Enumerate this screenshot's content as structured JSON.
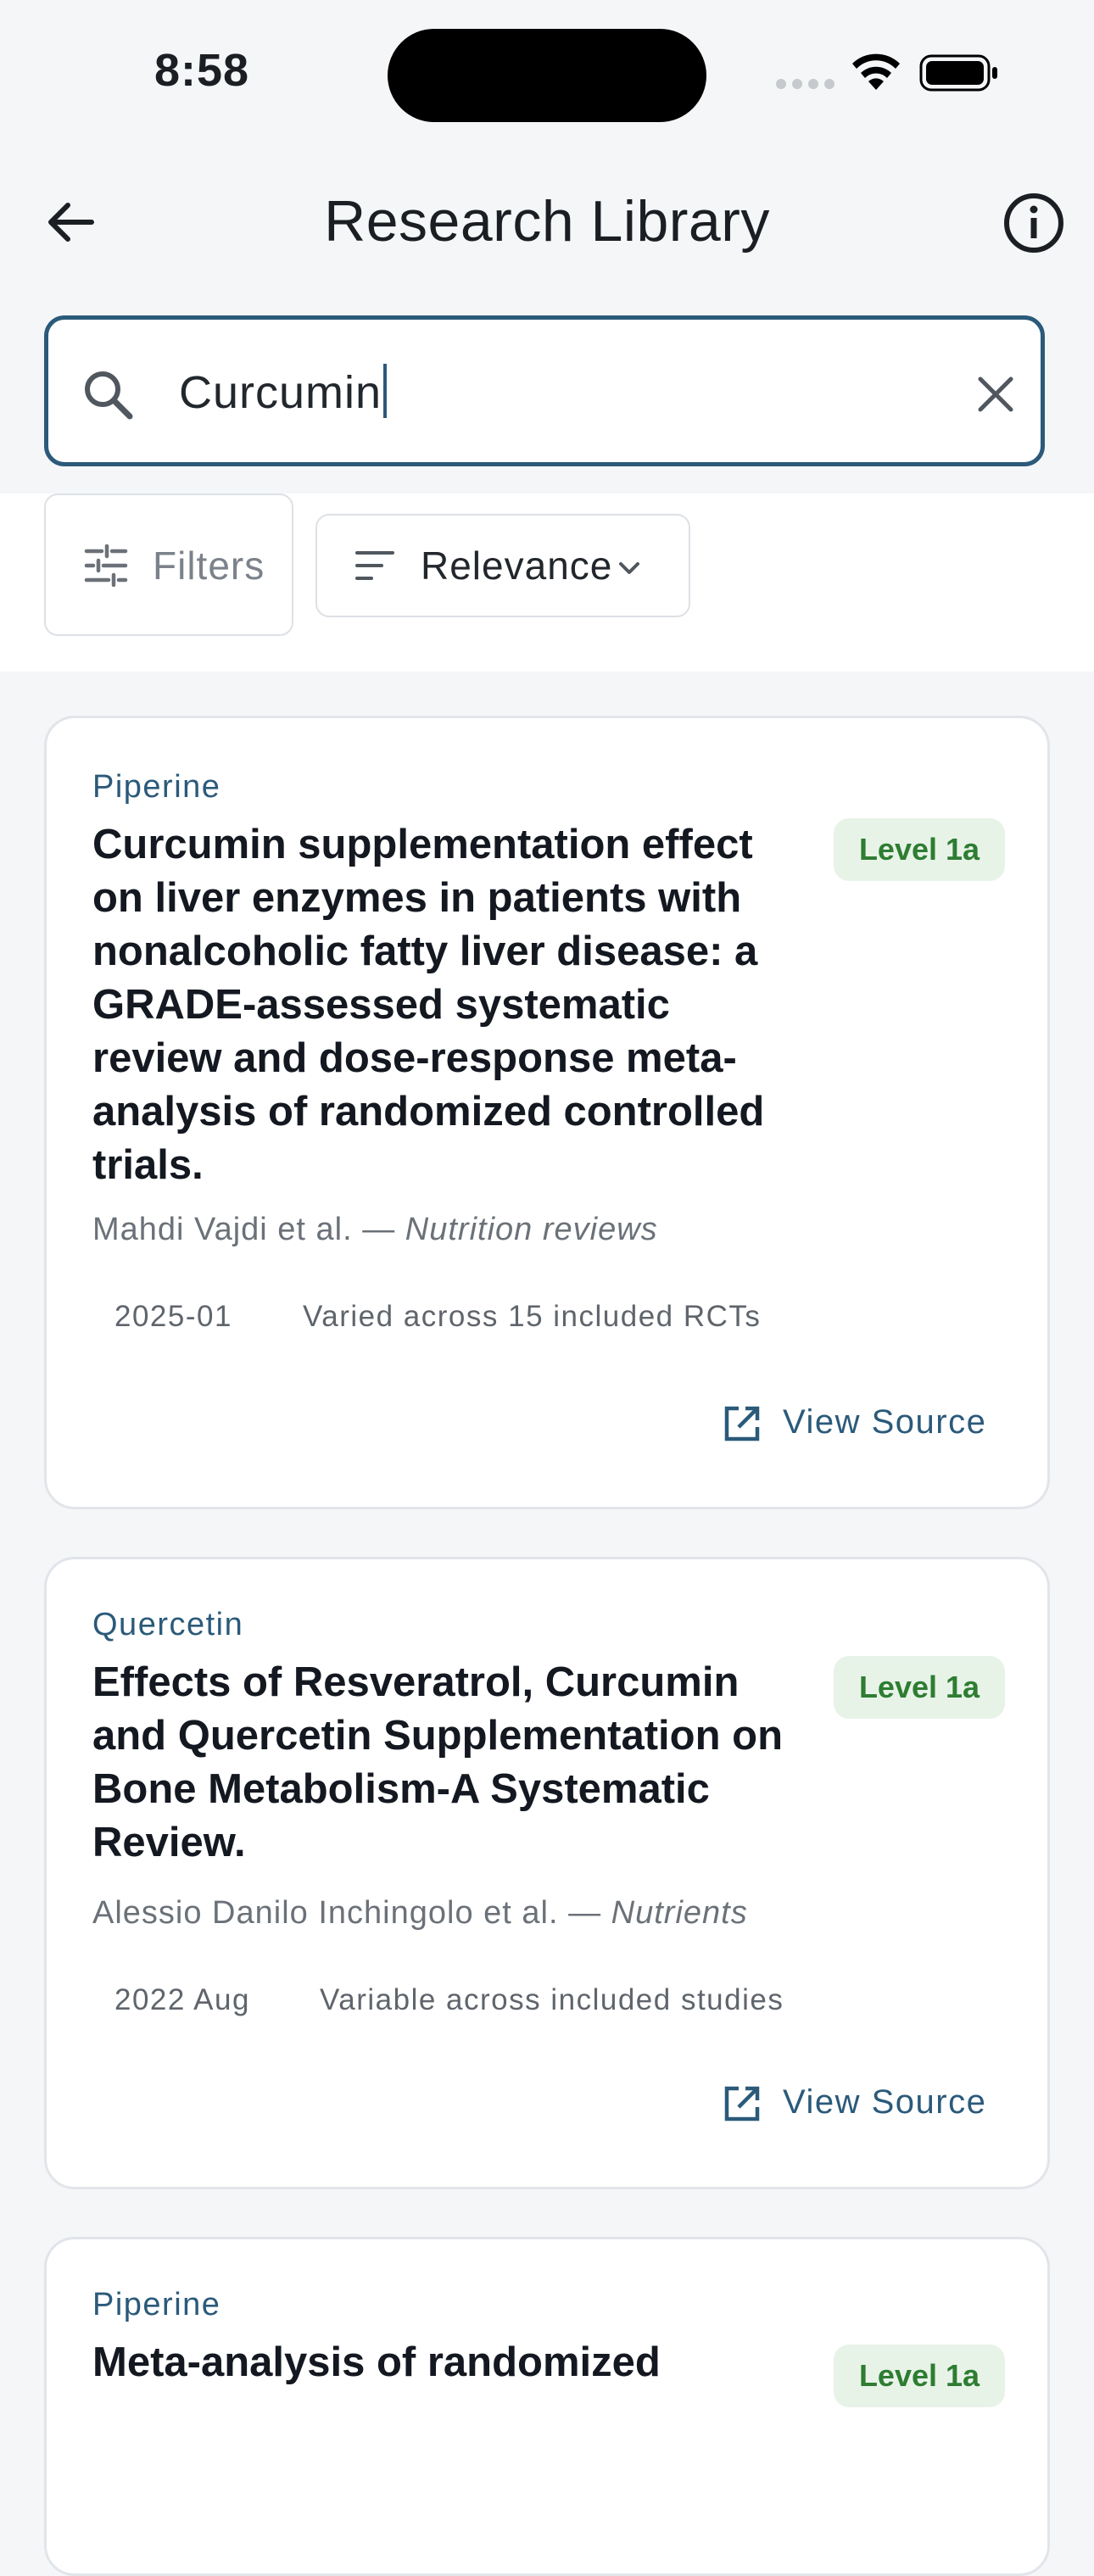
{
  "status_bar": {
    "time": "8:58"
  },
  "header": {
    "title": "Research Library"
  },
  "search": {
    "value": "Curcumin"
  },
  "toolbar": {
    "filters_label": "Filters",
    "sort_label": "Relevance"
  },
  "results": [
    {
      "supplement": "Piperine",
      "title": "Curcumin supplementation effect on liver enzymes in patients with nonalcoholic fatty liver disease: a GRADE-assessed systematic review and dose-response meta-analysis of randomized controlled trials.",
      "authors": "Mahdi Vajdi et al. — ",
      "journal": "Nutrition reviews",
      "evidence_level": "Level 1a",
      "date": "2025-01",
      "dosage": "Varied across 15 included RCTs",
      "view_source_label": "View Source"
    },
    {
      "supplement": "Quercetin",
      "title": "Effects of Resveratrol, Curcumin and Quercetin Supplementation on Bone Metabolism-A Systematic Review.",
      "authors": "Alessio Danilo Inchingolo et al. — ",
      "journal": "Nutrients",
      "evidence_level": "Level 1a",
      "date": "2022 Aug",
      "dosage": "Variable across included studies",
      "view_source_label": "View Source"
    },
    {
      "supplement": "Piperine",
      "title": "Meta-analysis of randomized",
      "evidence_level": "Level 1a"
    }
  ],
  "colors": {
    "accent": "#2b5a7a",
    "badge_bg": "#e8f3e8",
    "badge_text": "#2e7d32",
    "background": "#f4f6f8"
  },
  "icons": [
    "back-arrow-icon",
    "info-icon",
    "search-icon",
    "close-icon",
    "filters-icon",
    "sort-icon",
    "chevron-down-icon",
    "external-link-icon",
    "wifi-icon",
    "battery-icon",
    "signal-icon"
  ]
}
